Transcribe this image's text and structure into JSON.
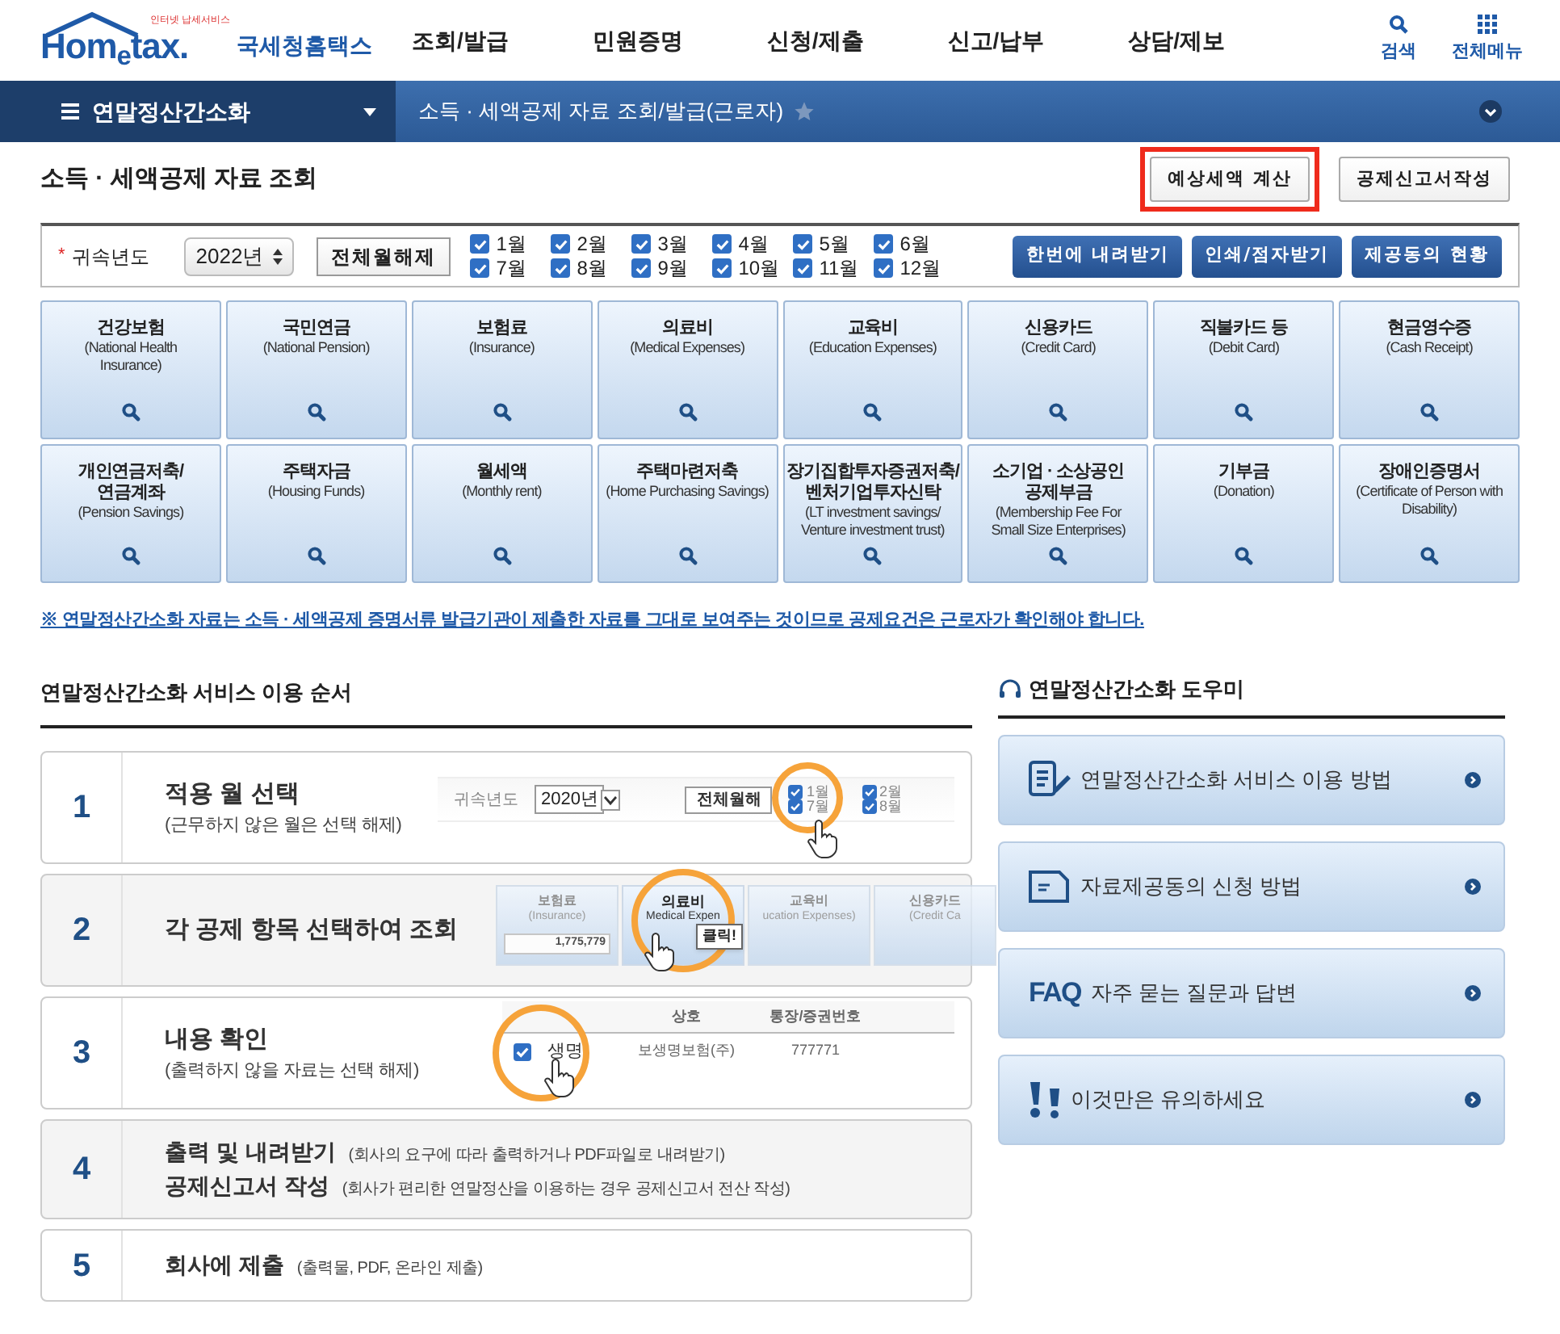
{
  "logo": {
    "tagline": "인터넷 납세서비스",
    "name_en": "Hom$_{e}$tax.",
    "name_ko": "국세청홈택스"
  },
  "main_menu": [
    "조회/발급",
    "민원증명",
    "신청/제출",
    "신고/납부",
    "상담/제보"
  ],
  "header_tools": [
    {
      "kind": "search",
      "label": "검색"
    },
    {
      "kind": "grid",
      "label": "전체메뉴"
    }
  ],
  "nav": {
    "section": "연말정산간소화",
    "breadcrumb": "소득 · 세액공제 자료 조회/발급(근로자)",
    "favorite": false
  },
  "page_title": "소득 · 세액공제 자료 조회",
  "top_buttons": [
    {
      "label": "예상세액 계산",
      "highlighted": true
    },
    {
      "label": "공제신고서작성",
      "highlighted": false
    }
  ],
  "filter": {
    "required_mark": "*",
    "label": "귀속년도",
    "year": "2022년",
    "clear_button": "전체월해제",
    "months": [
      {
        "label": "1월",
        "checked": true
      },
      {
        "label": "2월",
        "checked": true
      },
      {
        "label": "3월",
        "checked": true
      },
      {
        "label": "4월",
        "checked": true
      },
      {
        "label": "5월",
        "checked": true
      },
      {
        "label": "6월",
        "checked": true
      },
      {
        "label": "7월",
        "checked": true
      },
      {
        "label": "8월",
        "checked": true
      },
      {
        "label": "9월",
        "checked": true
      },
      {
        "label": "10월",
        "checked": true
      },
      {
        "label": "11월",
        "checked": true
      },
      {
        "label": "12월",
        "checked": true
      }
    ],
    "actions": [
      "한번에 내려받기",
      "인쇄/점자받기",
      "제공동의 현황"
    ]
  },
  "categories": [
    {
      "title": "건강보험",
      "subtitle": "(National Health\nInsurance)"
    },
    {
      "title": "국민연금",
      "subtitle": "(National Pension)"
    },
    {
      "title": "보험료",
      "subtitle": "(Insurance)"
    },
    {
      "title": "의료비",
      "subtitle": "(Medical Expenses)"
    },
    {
      "title": "교육비",
      "subtitle": "(Education Expenses)"
    },
    {
      "title": "신용카드",
      "subtitle": "(Credit Card)"
    },
    {
      "title": "직불카드 등",
      "subtitle": "(Debit Card)"
    },
    {
      "title": "현금영수증",
      "subtitle": "(Cash Receipt)"
    },
    {
      "title": "개인연금저축/\n연금계좌",
      "subtitle": "(Pension Savings)"
    },
    {
      "title": "주택자금",
      "subtitle": "(Housing Funds)"
    },
    {
      "title": "월세액",
      "subtitle": "(Monthly rent)"
    },
    {
      "title": "주택마련저축",
      "subtitle": "(Home Purchasing Savings)"
    },
    {
      "title": "장기집합투자증권저축/\n벤처기업투자신탁",
      "subtitle": "(LT investment savings/\nVenture investment trust)"
    },
    {
      "title": "소기업 · 소상공인\n공제부금",
      "subtitle": "(Membership Fee For\nSmall Size Enterprises)"
    },
    {
      "title": "기부금",
      "subtitle": "(Donation)"
    },
    {
      "title": "장애인증명서",
      "subtitle": "(Certificate of Person with\nDisability)"
    }
  ],
  "notice": "※ 연말정산간소화 자료는 소득 · 세액공제 증명서류 발급기관이 제출한 자료를 그대로 보여주는 것이므로 공제요건은 근로자가 확인해야 합니다.",
  "steps_heading": "연말정산간소화 서비스 이용 순서",
  "steps": [
    {
      "number": "1",
      "kind": "stacked",
      "lines": [
        {
          "title": "적용 월 선택",
          "note": "(근무하지 않은 월은 선택 해제)"
        }
      ],
      "illustration": {
        "kind": "months",
        "label": "귀속년도",
        "year": "2020년",
        "button": "전체월해",
        "months": [
          {
            "label": "1월",
            "checked": true
          },
          {
            "label": "7월",
            "checked": true
          },
          {
            "label": "2월",
            "checked": true
          },
          {
            "label": "8월",
            "checked": true
          }
        ]
      }
    },
    {
      "number": "2",
      "kind": "stacked",
      "lines": [
        {
          "title": "각 공제 항목 선택하여 조회"
        }
      ],
      "illustration": {
        "kind": "tiles",
        "callout": "클릭!",
        "tiles": [
          {
            "title": "보험료",
            "subtitle": "(Insurance)",
            "amount": "1,775,779",
            "highlighted": false
          },
          {
            "title": "의료비",
            "subtitle": "Medical Expen",
            "highlighted": true
          },
          {
            "title": "교육비",
            "subtitle": "ucation Expenses)",
            "highlighted": false
          },
          {
            "title": "신용카드",
            "subtitle": "(Credit Ca",
            "highlighted": false
          }
        ]
      }
    },
    {
      "number": "3",
      "kind": "stacked",
      "lines": [
        {
          "title": "내용 확인",
          "note": "(출력하지 않을 자료는 선택 해제)"
        }
      ],
      "illustration": {
        "kind": "table",
        "columns": [
          "상호",
          "통장/증권번호"
        ],
        "rows": [
          {
            "checked": true,
            "name_zoom": "생명",
            "name": "보생명보험(주)",
            "number": "777771"
          }
        ]
      }
    },
    {
      "number": "4",
      "kind": "inline",
      "lines": [
        {
          "title": "출력 및 내려받기",
          "note": "(회사의 요구에 따라 출력하거나 PDF파일로 내려받기)"
        },
        {
          "title": "공제신고서 작성",
          "note": "(회사가 편리한 연말정산을 이용하는 경우 공제신고서 전산 작성)"
        }
      ]
    },
    {
      "number": "5",
      "kind": "inline",
      "lines": [
        {
          "title": "회사에 제출",
          "note": "(출력물, PDF, 온라인 제출)"
        }
      ]
    }
  ],
  "helper_heading": "연말정산간소화 도우미",
  "helper_items": [
    {
      "kind": "guide",
      "label": "연말정산간소화 서비스 이용 방법"
    },
    {
      "kind": "form",
      "label": "자료제공동의 신청 방법"
    },
    {
      "kind": "faq",
      "icon_text": "FAQ",
      "label": "자주 묻는 질문과 답변"
    },
    {
      "kind": "caution",
      "label": "이것만은 유의하세요"
    }
  ]
}
